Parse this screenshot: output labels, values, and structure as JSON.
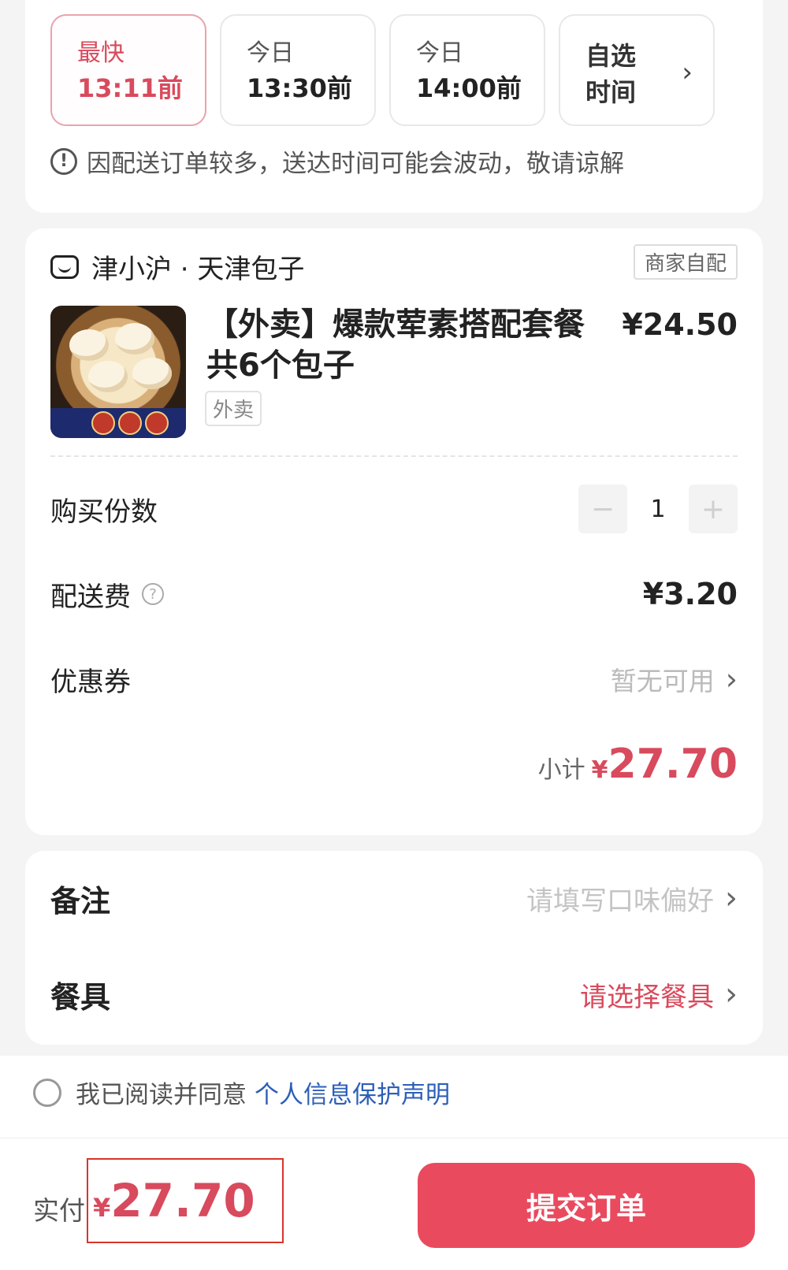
{
  "time_slots": [
    {
      "line1": "最快",
      "line2": "13:11前"
    },
    {
      "line1": "今日",
      "line2": "13:30前"
    },
    {
      "line1": "今日",
      "line2": "14:00前"
    }
  ],
  "custom_slot": {
    "line1": "自选",
    "line2": "时间"
  },
  "delivery_notice": "因配送订单较多，送达时间可能会波动，敬请谅解",
  "shop": {
    "name": "津小沪 · 天津包子",
    "badge": "商家自配"
  },
  "product": {
    "title": "【外卖】爆款荤素搭配套餐共6个包子",
    "price": "¥24.50",
    "tag": "外卖"
  },
  "quantity": {
    "label": "购买份数",
    "value": "1"
  },
  "delivery_fee": {
    "label": "配送费",
    "value": "¥3.20"
  },
  "coupon": {
    "label": "优惠券",
    "value": "暂无可用"
  },
  "subtotal": {
    "label": "小计",
    "currency": "¥",
    "amount": "27.70"
  },
  "remark": {
    "label": "备注",
    "placeholder": "请填写口味偏好"
  },
  "tableware": {
    "label": "餐具",
    "value": "请选择餐具"
  },
  "agreement": {
    "text": "我已阅读并同意",
    "link": "个人信息保护声明"
  },
  "payment": {
    "label": "实付",
    "currency": "¥",
    "amount": "27.70"
  },
  "submit_label": "提交订单",
  "colors": {
    "accent": "#ea4a5e",
    "price_red": "#d84a5d",
    "link_blue": "#2d5fb8",
    "highlight_box": "#d9342b"
  }
}
